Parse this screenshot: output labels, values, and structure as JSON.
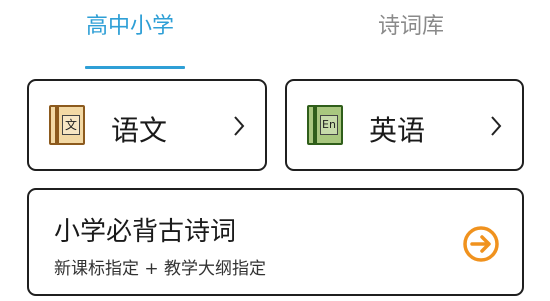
{
  "tabs": [
    {
      "label": "高中小学",
      "active": true
    },
    {
      "label": "诗词库",
      "active": false
    }
  ],
  "colors": {
    "accent": "#2e9fd6",
    "text": "#1a1a1a",
    "inactive_tab": "#8a8a8a",
    "orange": "#f0921e"
  },
  "subjects": [
    {
      "label": "语文",
      "icon": "chinese-book-icon",
      "icon_glyph": "文"
    },
    {
      "label": "英语",
      "icon": "english-book-icon",
      "icon_glyph": "En"
    }
  ],
  "poems_card": {
    "title": "小学必背古诗词",
    "subtitle": "新课标指定 + 教学大纲指定",
    "icon": "arrow-circle-right-icon"
  }
}
